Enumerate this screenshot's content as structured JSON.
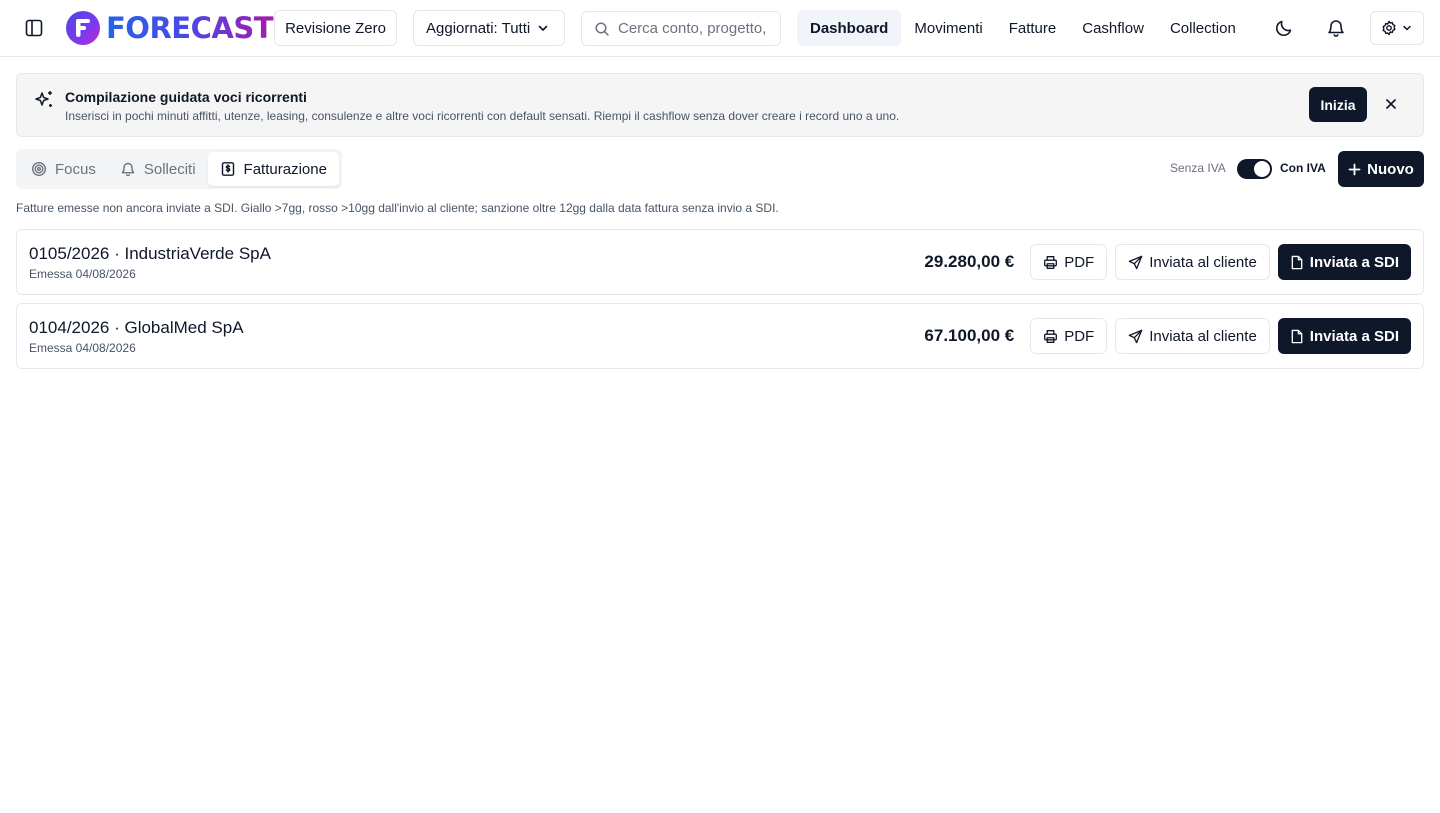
{
  "app": {
    "brand": "FORECASTO"
  },
  "header": {
    "revision_label": "Revisione Zero",
    "updated_filter_label": "Aggiornati: Tutti",
    "search_placeholder": "Cerca conto, progetto, ...",
    "nav": [
      {
        "label": "Dashboard",
        "active": true
      },
      {
        "label": "Movimenti",
        "active": false
      },
      {
        "label": "Fatture",
        "active": false
      },
      {
        "label": "Cashflow",
        "active": false
      },
      {
        "label": "Collection",
        "active": false
      }
    ],
    "icons": [
      "sidebar-toggle-icon",
      "moon-icon",
      "bell-icon",
      "gear-icon",
      "chevron-down-icon"
    ]
  },
  "banner": {
    "title": "Compilazione guidata voci ricorrenti",
    "description": "Inserisci in pochi minuti affitti, utenze, leasing, consulenze e altre voci ricorrenti con default sensati. Riempi il cashflow senza dover creare i record uno a uno.",
    "start_label": "Inizia",
    "icon": "sparkles-icon"
  },
  "tabs": [
    {
      "label": "Focus",
      "icon": "target-icon",
      "active": false
    },
    {
      "label": "Solleciti",
      "icon": "bell-icon",
      "active": false
    },
    {
      "label": "Fatturazione",
      "icon": "invoice-icon",
      "active": true
    }
  ],
  "vat_toggle": {
    "off_label": "Senza IVA",
    "on_label": "Con IVA",
    "value": "Con IVA"
  },
  "new_button_label": "Nuovo",
  "hint": "Fatture emesse non ancora inviate a SDI. Giallo >7gg, rosso >10gg dall'invio al cliente; sanzione oltre 12gg dalla data fattura senza invio a SDI.",
  "invoices": [
    {
      "title": "0105/2026 · IndustriaVerde SpA",
      "date": "Emessa 04/08/2026",
      "amount": "29.280,00 €",
      "pdf_label": "PDF",
      "sent_client_label": "Inviata al cliente",
      "sent_sdi_label": "Inviata a SDI"
    },
    {
      "title": "0104/2026 · GlobalMed SpA",
      "date": "Emessa 04/08/2026",
      "amount": "67.100,00 €",
      "pdf_label": "PDF",
      "sent_client_label": "Inviata al cliente",
      "sent_sdi_label": "Inviata a SDI"
    }
  ],
  "colors": {
    "primary_dark": "#0f172a",
    "border": "#e5e7eb",
    "muted_text": "#6b7280",
    "banner_bg": "#f5f5f5"
  }
}
